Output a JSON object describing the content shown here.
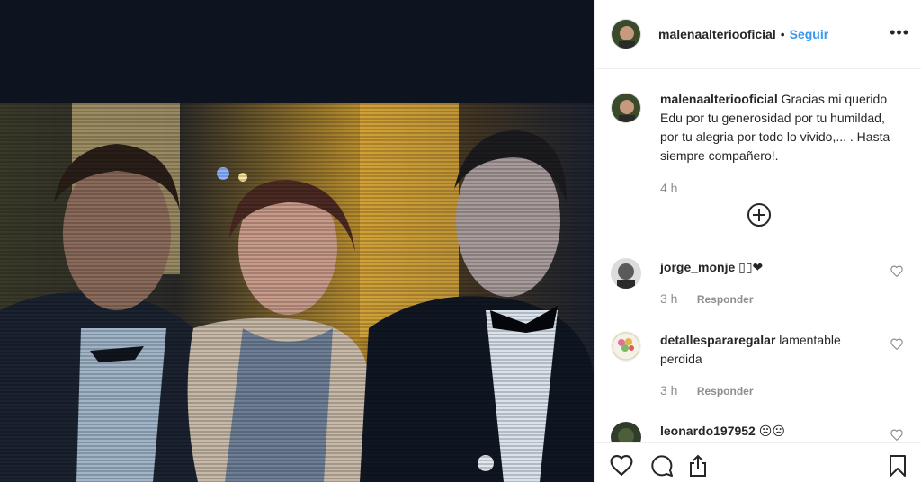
{
  "post": {
    "username": "malenaalteriooficial",
    "separator": "•",
    "follow_label": "Seguir",
    "more_label": "•••"
  },
  "caption": {
    "username": "malenaalteriooficial",
    "text": "Gracias mi querido Edu por tu generosidad por tu humildad, por tu alegria por todo lo vivido,... . Hasta siempre compañero!.",
    "time": "4 h"
  },
  "comments": [
    {
      "username": "jorge_monje",
      "text": "▯▯❤",
      "time": "3 h",
      "reply": "Responder"
    },
    {
      "username": "detallespararegalar",
      "text": "lamentable perdida",
      "time": "3 h",
      "reply": "Responder"
    },
    {
      "username": "leonardo197952",
      "text": "☹☹"
    }
  ],
  "icons": {
    "like": "heart-icon",
    "comment": "comment-icon",
    "share": "share-icon",
    "save": "bookmark-icon",
    "load_more": "plus-circle-icon"
  },
  "colors": {
    "link": "#3897f0",
    "muted": "#8e8e8e",
    "text": "#262626"
  }
}
